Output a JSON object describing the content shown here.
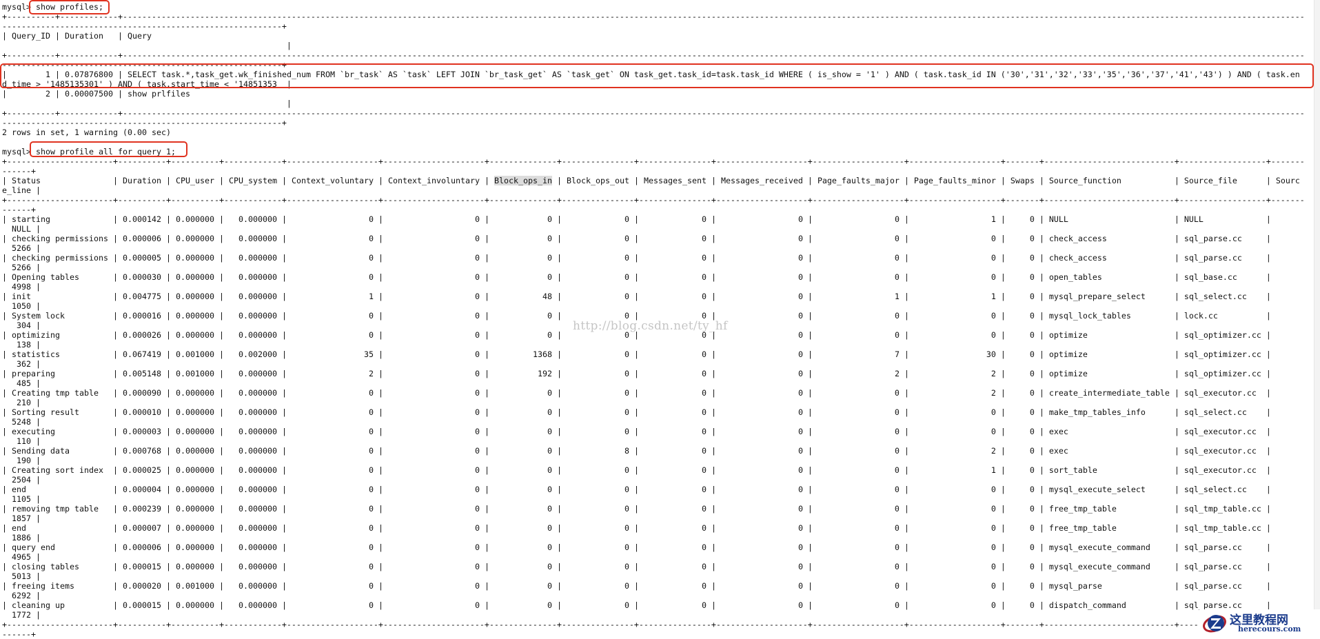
{
  "prompt": "mysql> ",
  "commands": [
    "show profiles;",
    "show profile all for query 1;"
  ],
  "profiles": {
    "columns": [
      "Query_ID",
      "Duration",
      "Query"
    ],
    "rows": [
      [
        "1",
        "0.07876800",
        "SELECT task.*,task_get.wk_finished_num FROM `br_task` AS `task` LEFT JOIN `br_task_get` AS `task_get` ON task_get.task_id=task.task_id WHERE ( is_show = '1' ) AND ( task.task_id IN ('30','31','32','33','35','36','37','41','43') ) AND ( task.end_time > '1485135301' ) AND ( task.start_time < '14851353"
      ],
      [
        "2",
        "0.00007500",
        "show prlfiles"
      ]
    ],
    "summary": "2 rows in set, 1 warning (0.00 sec)"
  },
  "profile": {
    "columns": [
      "Status",
      "Duration",
      "CPU_user",
      "CPU_system",
      "Context_voluntary",
      "Context_involuntary",
      "Block_ops_in",
      "Block_ops_out",
      "Messages_sent",
      "Messages_received",
      "Page_faults_major",
      "Page_faults_minor",
      "Swaps",
      "Source_function",
      "Source_file",
      "Source_line"
    ],
    "rows": [
      [
        "starting",
        "0.000142",
        "0.000000",
        "0.000000",
        "0",
        "0",
        "0",
        "0",
        "0",
        "0",
        "0",
        "1",
        "0",
        "NULL",
        "NULL",
        "NULL"
      ],
      [
        "checking permissions",
        "0.000006",
        "0.000000",
        "0.000000",
        "0",
        "0",
        "0",
        "0",
        "0",
        "0",
        "0",
        "0",
        "0",
        "check_access",
        "sql_parse.cc",
        "5266"
      ],
      [
        "checking permissions",
        "0.000005",
        "0.000000",
        "0.000000",
        "0",
        "0",
        "0",
        "0",
        "0",
        "0",
        "0",
        "0",
        "0",
        "check_access",
        "sql_parse.cc",
        "5266"
      ],
      [
        "Opening tables",
        "0.000030",
        "0.000000",
        "0.000000",
        "0",
        "0",
        "0",
        "0",
        "0",
        "0",
        "0",
        "0",
        "0",
        "open_tables",
        "sql_base.cc",
        "4998"
      ],
      [
        "init",
        "0.004775",
        "0.000000",
        "0.000000",
        "1",
        "0",
        "48",
        "0",
        "0",
        "0",
        "1",
        "1",
        "0",
        "mysql_prepare_select",
        "sql_select.cc",
        "1050"
      ],
      [
        "System lock",
        "0.000016",
        "0.000000",
        "0.000000",
        "0",
        "0",
        "0",
        "0",
        "0",
        "0",
        "0",
        "0",
        "0",
        "mysql_lock_tables",
        "lock.cc",
        "304"
      ],
      [
        "optimizing",
        "0.000026",
        "0.000000",
        "0.000000",
        "0",
        "0",
        "0",
        "0",
        "0",
        "0",
        "0",
        "0",
        "0",
        "optimize",
        "sql_optimizer.cc",
        "138"
      ],
      [
        "statistics",
        "0.067419",
        "0.001000",
        "0.002000",
        "35",
        "0",
        "1368",
        "0",
        "0",
        "0",
        "7",
        "30",
        "0",
        "optimize",
        "sql_optimizer.cc",
        "362"
      ],
      [
        "preparing",
        "0.005148",
        "0.001000",
        "0.000000",
        "2",
        "0",
        "192",
        "0",
        "0",
        "0",
        "2",
        "2",
        "0",
        "optimize",
        "sql_optimizer.cc",
        "485"
      ],
      [
        "Creating tmp table",
        "0.000090",
        "0.000000",
        "0.000000",
        "0",
        "0",
        "0",
        "0",
        "0",
        "0",
        "0",
        "2",
        "0",
        "create_intermediate_table",
        "sql_executor.cc",
        "210"
      ],
      [
        "Sorting result",
        "0.000010",
        "0.000000",
        "0.000000",
        "0",
        "0",
        "0",
        "0",
        "0",
        "0",
        "0",
        "0",
        "0",
        "make_tmp_tables_info",
        "sql_select.cc",
        "5248"
      ],
      [
        "executing",
        "0.000003",
        "0.000000",
        "0.000000",
        "0",
        "0",
        "0",
        "0",
        "0",
        "0",
        "0",
        "0",
        "0",
        "exec",
        "sql_executor.cc",
        "110"
      ],
      [
        "Sending data",
        "0.000768",
        "0.000000",
        "0.000000",
        "0",
        "0",
        "0",
        "8",
        "0",
        "0",
        "0",
        "2",
        "0",
        "exec",
        "sql_executor.cc",
        "190"
      ],
      [
        "Creating sort index",
        "0.000025",
        "0.000000",
        "0.000000",
        "0",
        "0",
        "0",
        "0",
        "0",
        "0",
        "0",
        "1",
        "0",
        "sort_table",
        "sql_executor.cc",
        "2504"
      ],
      [
        "end",
        "0.000004",
        "0.000000",
        "0.000000",
        "0",
        "0",
        "0",
        "0",
        "0",
        "0",
        "0",
        "0",
        "0",
        "mysql_execute_select",
        "sql_select.cc",
        "1105"
      ],
      [
        "removing tmp table",
        "0.000239",
        "0.000000",
        "0.000000",
        "0",
        "0",
        "0",
        "0",
        "0",
        "0",
        "0",
        "0",
        "0",
        "free_tmp_table",
        "sql_tmp_table.cc",
        "1857"
      ],
      [
        "end",
        "0.000007",
        "0.000000",
        "0.000000",
        "0",
        "0",
        "0",
        "0",
        "0",
        "0",
        "0",
        "0",
        "0",
        "free_tmp_table",
        "sql_tmp_table.cc",
        "1886"
      ],
      [
        "query end",
        "0.000006",
        "0.000000",
        "0.000000",
        "0",
        "0",
        "0",
        "0",
        "0",
        "0",
        "0",
        "0",
        "0",
        "mysql_execute_command",
        "sql_parse.cc",
        "4965"
      ],
      [
        "closing tables",
        "0.000015",
        "0.000000",
        "0.000000",
        "0",
        "0",
        "0",
        "0",
        "0",
        "0",
        "0",
        "0",
        "0",
        "mysql_execute_command",
        "sql_parse.cc",
        "5013"
      ],
      [
        "freeing items",
        "0.000020",
        "0.001000",
        "0.000000",
        "0",
        "0",
        "0",
        "0",
        "0",
        "0",
        "0",
        "0",
        "0",
        "mysql_parse",
        "sql_parse.cc",
        "6292"
      ],
      [
        "cleaning up",
        "0.000015",
        "0.000000",
        "0.000000",
        "0",
        "0",
        "0",
        "0",
        "0",
        "0",
        "0",
        "0",
        "0",
        "dispatch_command",
        "sql_parse.cc",
        "1772"
      ]
    ]
  },
  "watermark": "http://blog.csdn.net/ty_hf",
  "logo": {
    "cn": "这里教程网",
    "en": "herecours.com"
  },
  "colors": {
    "highlight_box": "#e0321f",
    "logo": "#1c3c8c"
  }
}
